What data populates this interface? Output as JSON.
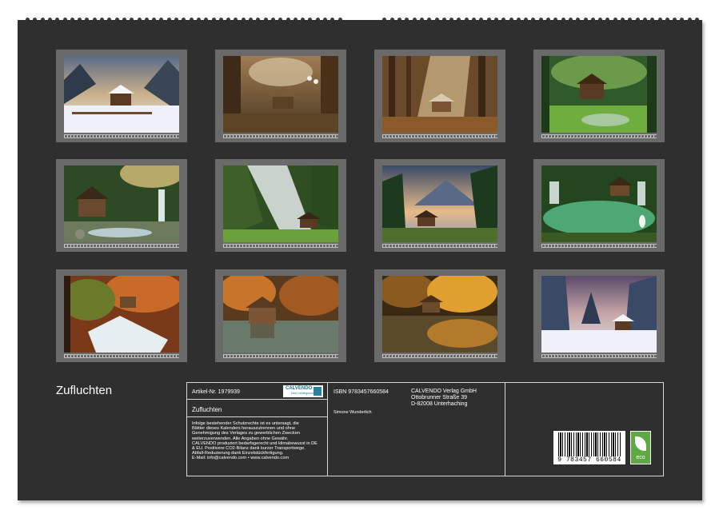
{
  "calendar": {
    "title": "Zufluchten",
    "months": [
      {
        "id": "jan",
        "scene": "winter-cabin"
      },
      {
        "id": "feb",
        "scene": "forest-cabin-birds"
      },
      {
        "id": "mar",
        "scene": "sunlit-forest-cabin"
      },
      {
        "id": "apr",
        "scene": "green-forest-cabin"
      },
      {
        "id": "may",
        "scene": "mill-stream"
      },
      {
        "id": "jun",
        "scene": "waterfall-cabin"
      },
      {
        "id": "jul",
        "scene": "mountain-lake-hut"
      },
      {
        "id": "aug",
        "scene": "lake-pavilion-heron"
      },
      {
        "id": "sep",
        "scene": "autumn-waterfall"
      },
      {
        "id": "oct",
        "scene": "autumn-lake-house"
      },
      {
        "id": "nov",
        "scene": "autumn-reflection"
      },
      {
        "id": "dec",
        "scene": "snowy-forest-hut"
      }
    ]
  },
  "info": {
    "article_no": "Artikel-Nr. 1979939",
    "product_title": "Zufluchten",
    "logo_text": "CALVENDO",
    "logo_sub": "Dein Lieblingsmoment",
    "notice_lines": [
      "Infolge bestehender Schutzrechte ist es untersagt, die",
      "Blätter dieses Kalenders herauszutrennen und ohne",
      "Genehmigung des Verlages zu gewerblichen Zwecken",
      "weiterzuverwenden. Alle Angaben ohne Gewähr.",
      "CALVENDO produziert bedarfsgerecht und klimabewusst in DE",
      "& EU. Positivere CO2-Bilanz dank kurzer Transportwege.",
      "Abfall-Reduzierung dank Einzelstückfertigung.",
      "E-Mail: info@calvendo.com • www.calvendo.com"
    ],
    "isbn": "ISBN 9783457660584",
    "author": "Simone Wunderlich",
    "publisher_lines": [
      "CALVENDO Verlag GmbH",
      "Ottobrunner Straße 39",
      "D-82008 Unterhaching"
    ],
    "barcode_number": "9 783457 660584",
    "eco_label": "eco"
  },
  "colors": {
    "sheet": "#2f2f2f",
    "frame": "#6a6a6a",
    "text": "#ffffff",
    "eco": "#5ea944",
    "brand": "#1c6f8c"
  }
}
